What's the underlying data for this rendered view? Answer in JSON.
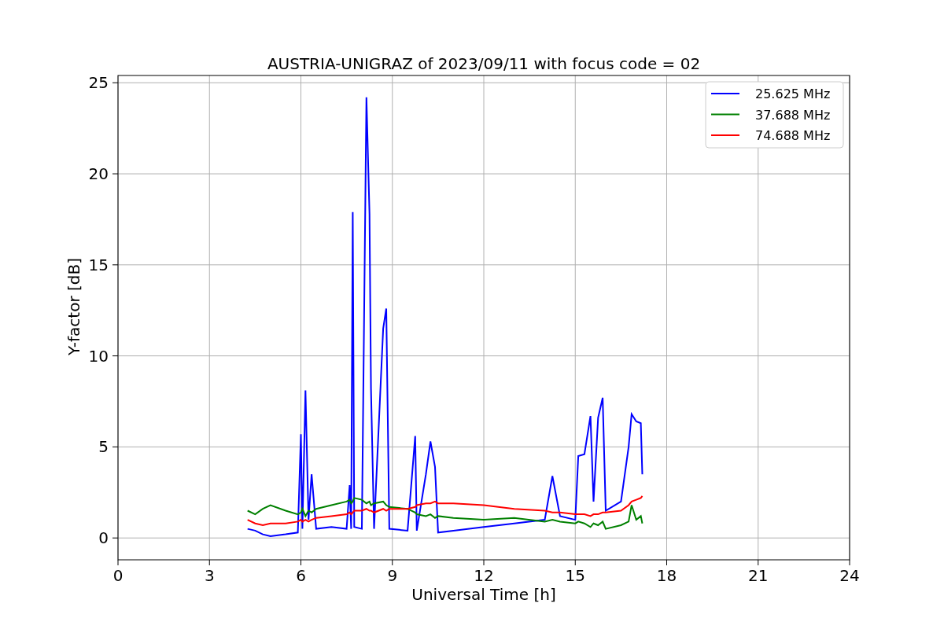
{
  "figure": {
    "chart_data": {
      "type": "line",
      "title": "AUSTRIA-UNIGRAZ of 2023/09/11 with focus code = 02",
      "xlabel": "Universal Time [h]",
      "ylabel": "Y-factor [dB]",
      "x": [
        4.25,
        4.5,
        4.75,
        5,
        5.5,
        5.9,
        6.0,
        6.05,
        6.15,
        6.25,
        6.35,
        6.5,
        7,
        7.5,
        7.6,
        7.65,
        7.7,
        7.75,
        8.0,
        8.15,
        8.25,
        8.3,
        8.4,
        8.7,
        8.8,
        8.9,
        9.5,
        9.75,
        9.8,
        10.1,
        10.25,
        10.4,
        10.5,
        11,
        12,
        13,
        14,
        14.25,
        14.5,
        15,
        15.1,
        15.3,
        15.5,
        15.6,
        15.75,
        15.9,
        16,
        16.5,
        16.75,
        16.85,
        17,
        17.15,
        17.2
      ],
      "series": [
        {
          "name": "25.625 MHz",
          "color": "#0000ff",
          "values": [
            0.5,
            0.4,
            0.2,
            0.1,
            0.2,
            0.3,
            5.7,
            0.5,
            8.1,
            1.0,
            3.5,
            0.5,
            0.6,
            0.5,
            2.9,
            0.5,
            17.9,
            0.6,
            0.5,
            24.2,
            17.8,
            8.2,
            0.5,
            11.5,
            12.6,
            0.5,
            0.4,
            5.6,
            0.4,
            3.5,
            5.3,
            3.9,
            0.3,
            0.4,
            0.6,
            0.8,
            1.0,
            3.4,
            1.2,
            1.0,
            4.5,
            4.6,
            6.7,
            2.0,
            6.6,
            7.7,
            1.5,
            2.0,
            5.0,
            6.8,
            6.4,
            6.3,
            3.5
          ]
        },
        {
          "name": "37.688 MHz",
          "color": "#008000",
          "values": [
            1.5,
            1.3,
            1.6,
            1.8,
            1.5,
            1.3,
            1.4,
            1.6,
            1.2,
            1.5,
            1.4,
            1.6,
            1.8,
            2.0,
            2.1,
            1.9,
            2.0,
            2.2,
            2.1,
            1.9,
            2.0,
            1.8,
            1.9,
            2.0,
            1.8,
            1.7,
            1.6,
            1.4,
            1.3,
            1.2,
            1.3,
            1.1,
            1.2,
            1.1,
            1.0,
            1.1,
            0.9,
            1.0,
            0.9,
            0.8,
            0.9,
            0.8,
            0.6,
            0.8,
            0.7,
            0.9,
            0.5,
            0.7,
            0.9,
            1.8,
            1.0,
            1.2,
            0.8
          ]
        },
        {
          "name": "74.688 MHz",
          "color": "#ff0000",
          "values": [
            1.0,
            0.8,
            0.7,
            0.8,
            0.8,
            0.9,
            1.0,
            0.9,
            1.0,
            0.9,
            1.0,
            1.1,
            1.2,
            1.3,
            1.4,
            1.3,
            1.4,
            1.5,
            1.5,
            1.6,
            1.5,
            1.5,
            1.4,
            1.6,
            1.5,
            1.6,
            1.6,
            1.7,
            1.8,
            1.9,
            1.9,
            2.0,
            1.9,
            1.9,
            1.8,
            1.6,
            1.5,
            1.4,
            1.4,
            1.3,
            1.3,
            1.3,
            1.2,
            1.3,
            1.3,
            1.4,
            1.4,
            1.5,
            1.8,
            2.0,
            2.1,
            2.2,
            2.3
          ]
        }
      ],
      "grid": true,
      "legend": true,
      "xlim": [
        0,
        24
      ],
      "ylim": [
        -1.2,
        25.4
      ],
      "xticks": [
        0,
        3,
        6,
        9,
        12,
        15,
        18,
        21,
        24
      ],
      "yticks": [
        0,
        5,
        10,
        15,
        20,
        25
      ]
    }
  }
}
